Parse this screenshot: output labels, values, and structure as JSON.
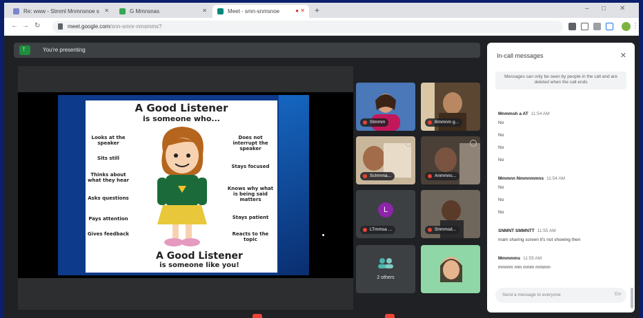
{
  "browser": {
    "tabs": [
      {
        "label": "Re: www - Stmml Mnmnsnoe s",
        "active": false,
        "favicon_color": "#7986cb"
      },
      {
        "label": "G Mmnsnas",
        "active": false,
        "favicon_color": "#34a853"
      },
      {
        "label": "Meet - smn-snmsnoe",
        "active": true,
        "favicon_color": "#00897b"
      }
    ],
    "new_tab_label": "+",
    "url": "meet.google.com",
    "url_rest": "/snn-smnr-nmsmms?",
    "window_controls": [
      "–",
      "□",
      "✕"
    ]
  },
  "meet": {
    "presenting_banner": "You're presenting",
    "slide": {
      "title": "A Good Listener",
      "subtitle": "is someone who...",
      "items_left": [
        "Looks at the speaker",
        "Sits still",
        "Thinks about what they hear",
        "Asks questions",
        "Pays attention",
        "Gives feedback"
      ],
      "items_right": [
        "Does not interrupt the speaker",
        "Stays focused",
        "Knows why what is being said matters",
        "Stays patient",
        "Reacts to the topic"
      ],
      "footer_title": "A Good Listener",
      "footer_sub": "is someone like you!"
    },
    "participants": [
      {
        "name": "Stmmm",
        "type": "video"
      },
      {
        "name": "Bmmnm g...",
        "type": "video"
      },
      {
        "name": "Schmma...",
        "type": "video"
      },
      {
        "name": "Anmmns...",
        "type": "video"
      },
      {
        "name": "LTmmsa ...",
        "type": "avatar",
        "letter": "L",
        "avatar_color": "#8e24aa"
      },
      {
        "name": "Snmmsd...",
        "type": "video"
      },
      {
        "name": "2 others",
        "type": "others"
      },
      {
        "name": "",
        "type": "video"
      }
    ]
  },
  "chat": {
    "title": "In-call messages",
    "close_icon": "close-icon",
    "note": "Messages can only be seen by people in the call and are deleted when the call ends",
    "groups": [
      {
        "sender": "Mnmmsh a AT",
        "time": "11:54 AM",
        "lines": [
          "No",
          "No",
          "No",
          "No"
        ]
      },
      {
        "sender": "Mmmnn Nmmnmmns",
        "time": "11:54 AM",
        "lines": [
          "No",
          "No",
          "No"
        ]
      },
      {
        "sender": "SNMNT SMMNTT",
        "time": "11:55 AM",
        "lines": [
          "mam sharing screen it's not showing then"
        ]
      },
      {
        "sender": "Mmmmms",
        "time": "11:55 AM",
        "lines": [
          "mmmm mm mmm mmmm"
        ]
      }
    ],
    "input_placeholder": "Send a message to everyone",
    "send_label": "Go"
  },
  "colors": {
    "outer_bg": "#0b1f6b",
    "meet_bg": "#202124",
    "present_green": "#1e8e3e",
    "slide_blue": "#0d3a8a"
  }
}
